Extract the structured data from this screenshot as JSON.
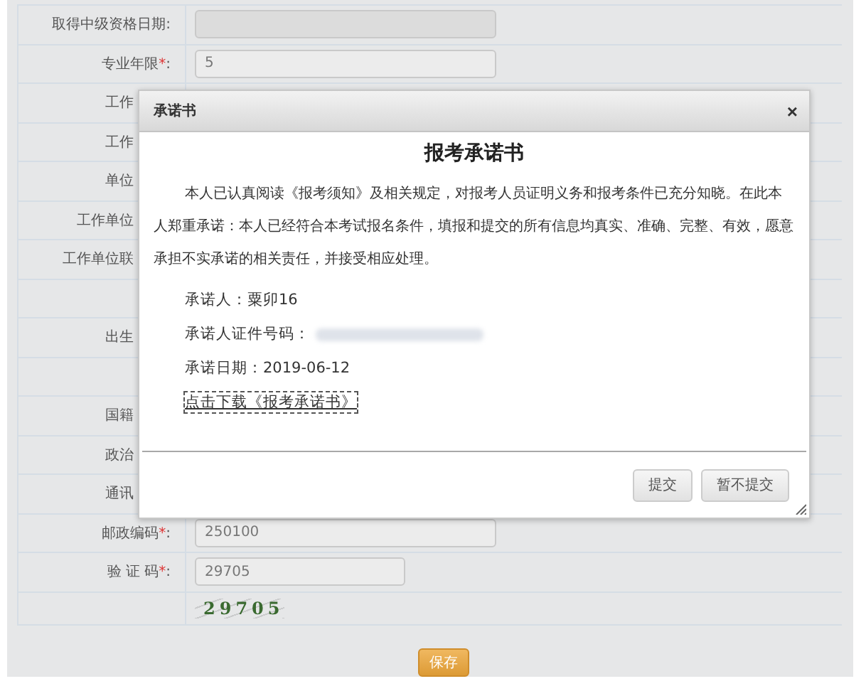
{
  "form": {
    "rows": [
      {
        "kind": "field",
        "label": "取得中级资格日期:",
        "field": {
          "disabled": true
        }
      },
      {
        "kind": "field",
        "label": "专业年限",
        "required": "*",
        "colon": ":",
        "field": {
          "value": "5",
          "disabled": false
        }
      },
      {
        "kind": "hidden",
        "label": "工作"
      },
      {
        "kind": "hidden",
        "label": "工作"
      },
      {
        "kind": "hidden",
        "label": "单位"
      },
      {
        "kind": "hidden",
        "label": "工作单位"
      },
      {
        "kind": "hidden",
        "label": "工作单位联"
      },
      {
        "kind": "hidden"
      },
      {
        "kind": "hidden",
        "label": "出生"
      },
      {
        "kind": "hidden"
      },
      {
        "kind": "hidden",
        "label": "国籍"
      },
      {
        "kind": "hidden",
        "label": "政治"
      },
      {
        "kind": "hidden",
        "label": "通讯"
      },
      {
        "kind": "field",
        "label": "邮政编码",
        "required": "*",
        "colon": ":",
        "field": {
          "value": "250100",
          "disabled": false
        }
      },
      {
        "kind": "field",
        "label": "验 证 码",
        "required": "*",
        "colon": ":",
        "field": {
          "value": "29705",
          "disabled": false,
          "short": true
        }
      }
    ],
    "captcha": "29705",
    "save_button": "保存"
  },
  "dialog": {
    "title": "承诺书",
    "close": "×",
    "heading": "报考承诺书",
    "paragraph": "本人已认真阅读《报考须知》及相关规定，对报考人员证明义务和报考条件已充分知晓。在此本人郑重承诺：本人已经符合本考试报名条件，填报和提交的所有信息均真实、准确、完整、有效，愿意承担不实承诺的相关责任，并接受相应处理。",
    "lines": [
      {
        "kind": "text",
        "text": "承诺人：粟卯16"
      },
      {
        "kind": "redacted",
        "text": "承诺人证件号码："
      },
      {
        "kind": "text",
        "text": "承诺日期：2019-06-12"
      }
    ],
    "download_link": "点击下载《报考承诺书》",
    "buttons": [
      "提交",
      "暂不提交"
    ]
  }
}
